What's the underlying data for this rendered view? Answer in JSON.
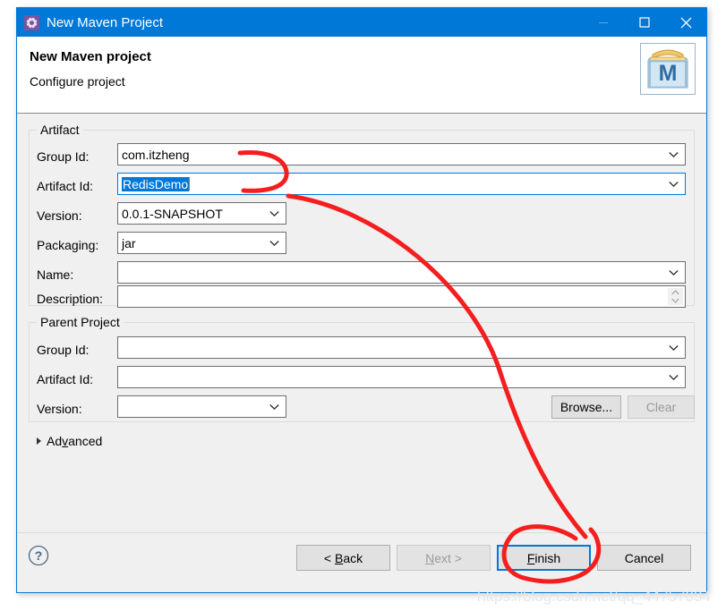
{
  "window": {
    "title": "New Maven Project",
    "title_icon": "gear-icon",
    "minimize_label": "–",
    "maximize_label": "□",
    "close_label": "✕"
  },
  "header": {
    "title": "New Maven project",
    "subtitle": "Configure project",
    "logo_letter": "M",
    "logo_name": "maven-logo"
  },
  "artifact": {
    "legend": "Artifact",
    "fields": [
      {
        "label": "Group Id:",
        "value": "com.itzheng",
        "type": "combo",
        "focused": false
      },
      {
        "label": "Artifact Id:",
        "value": "RedisDemo",
        "type": "combo",
        "focused": true
      },
      {
        "label": "Version:",
        "value": "0.0.1-SNAPSHOT",
        "type": "combo",
        "focused": false
      },
      {
        "label": "Packaging:",
        "value": "jar",
        "type": "combo",
        "focused": false
      },
      {
        "label": "Name:",
        "value": "",
        "type": "combo",
        "focused": false
      },
      {
        "label": "Description:",
        "value": "",
        "type": "spinner",
        "focused": false
      }
    ]
  },
  "parent": {
    "legend": "Parent Project",
    "fields": [
      {
        "label": "Group Id:",
        "value": "",
        "type": "combo"
      },
      {
        "label": "Artifact Id:",
        "value": "",
        "type": "combo"
      },
      {
        "label": "Version:",
        "value": "",
        "type": "combo"
      }
    ],
    "browse_label": "Browse...",
    "browse_mnemonic": "r",
    "clear_label": "Clear",
    "clear_disabled": true
  },
  "advanced": {
    "label_before": "Ad",
    "label_mnemonic": "v",
    "label_after": "anced",
    "expanded": false,
    "arrow": "chevron-right"
  },
  "footer": {
    "help_label": "?",
    "buttons": [
      {
        "name": "back",
        "before": "< ",
        "mnemonic": "B",
        "after": "ack",
        "disabled": false,
        "default": false
      },
      {
        "name": "next",
        "before": "",
        "mnemonic": "N",
        "after": "ext >",
        "disabled": true,
        "default": false
      },
      {
        "name": "finish",
        "before": "",
        "mnemonic": "F",
        "after": "inish",
        "disabled": false,
        "default": true
      },
      {
        "name": "cancel",
        "before": "",
        "mnemonic": "",
        "after": "Cancel",
        "disabled": false,
        "default": false
      }
    ]
  },
  "annotation": {
    "color": "#f41e1e",
    "shapes": [
      "bracket-near-artifact-id",
      "curve-to-finish",
      "circle-around-finish"
    ]
  },
  "watermark": {
    "text": "https://blog.csdn.net/qq_44757034"
  }
}
